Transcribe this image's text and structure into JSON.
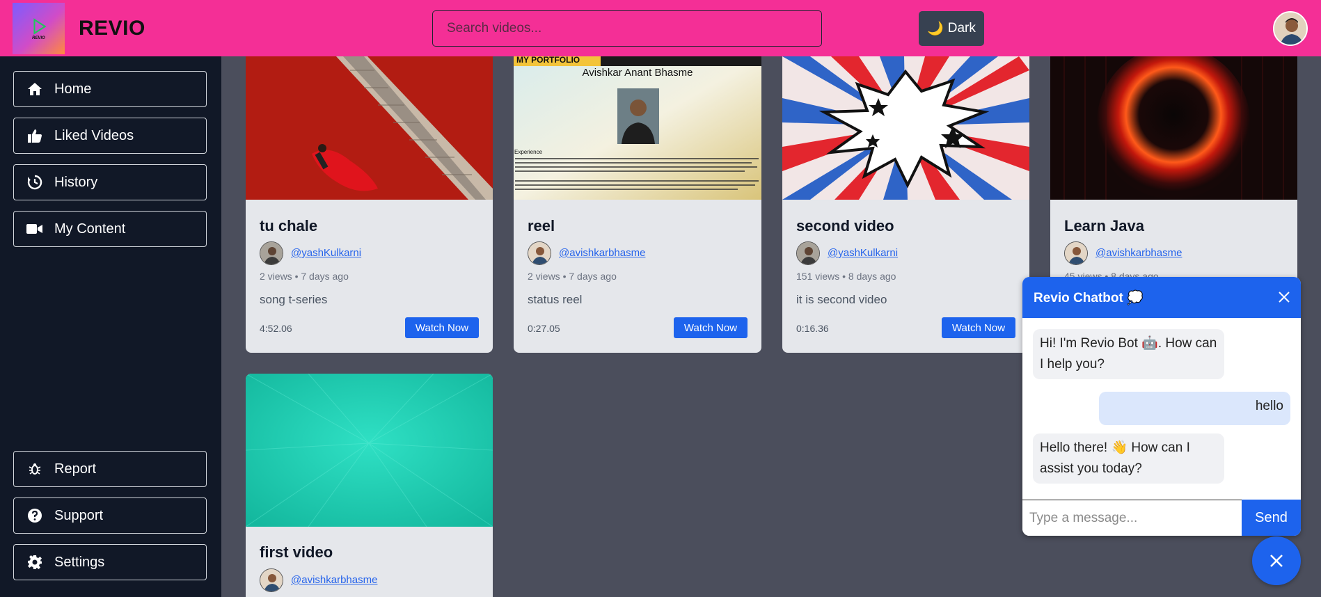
{
  "header": {
    "logo_text": "REVIO",
    "brand": "REVIO",
    "search_placeholder": "Search videos...",
    "theme_button": "Dark",
    "theme_icon": "moon-icon"
  },
  "sidebar": {
    "top_items": [
      {
        "label": "Home",
        "icon": "home-icon"
      },
      {
        "label": "Liked Videos",
        "icon": "thumbs-up-icon"
      },
      {
        "label": "History",
        "icon": "history-icon"
      },
      {
        "label": "My Content",
        "icon": "video-camera-icon"
      }
    ],
    "bottom_items": [
      {
        "label": "Report",
        "icon": "bug-icon"
      },
      {
        "label": "Support",
        "icon": "question-circle-icon"
      },
      {
        "label": "Settings",
        "icon": "gear-icon"
      }
    ]
  },
  "videos": [
    {
      "title": "tu chale",
      "handle": "@yashKulkarni",
      "meta": "2 views • 7 days ago",
      "description": "song t-series",
      "duration": "4:52.06",
      "button": "Watch Now"
    },
    {
      "title": "reel",
      "handle": "@avishkarbhasme",
      "meta": "2 views • 7 days ago",
      "description": "status reel",
      "duration": "0:27.05",
      "button": "Watch Now",
      "thumb_banner": "MY PORTFOLIO",
      "thumb_name": "Avishkar Anant Bhasme",
      "thumb_section": "Experience"
    },
    {
      "title": "second video",
      "handle": "@yashKulkarni",
      "meta": "151 views • 8 days ago",
      "description": "it is second video",
      "duration": "0:16.36",
      "button": "Watch Now"
    },
    {
      "title": "Learn Java",
      "handle": "@avishkarbhasme",
      "meta": "45 views • 8 days ago",
      "description": "",
      "duration": "",
      "button": ""
    },
    {
      "title": "first video",
      "handle": "@avishkarbhasme",
      "meta": "",
      "description": "",
      "duration": "",
      "button": ""
    }
  ],
  "chatbot": {
    "title": "Revio Chatbot 💭",
    "messages": [
      {
        "from": "bot",
        "text": "Hi! I'm Revio Bot 🤖. How can I help you?"
      },
      {
        "from": "user",
        "text": "hello"
      },
      {
        "from": "bot",
        "text": "Hello there! 👋 How can I assist you today?"
      }
    ],
    "input_placeholder": "Type a message...",
    "send_label": "Send"
  },
  "colors": {
    "header": "#f42f96",
    "sidebar": "#111827",
    "content_bg": "#4b4e5c",
    "accent": "#1d63ed"
  }
}
